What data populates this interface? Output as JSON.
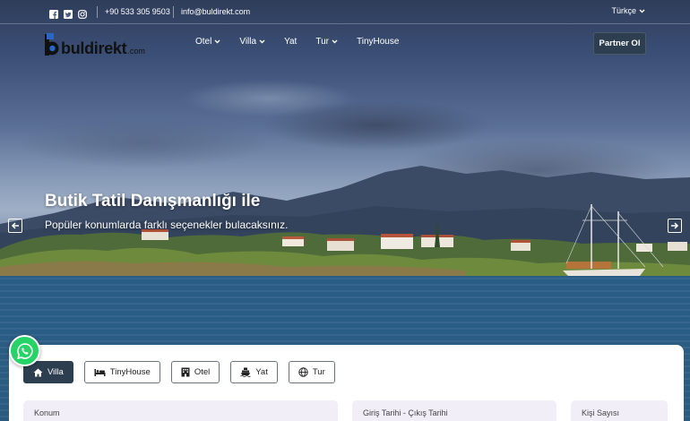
{
  "topbar": {
    "phone": "+90 533 305 9503",
    "email": "info@buldirekt.com",
    "language": "Türkçe",
    "social_icons": [
      "facebook-icon",
      "twitter-icon",
      "instagram-icon"
    ]
  },
  "logo": {
    "text": "buldirekt",
    "domain": ".com"
  },
  "nav": {
    "items": [
      {
        "label": "Otel",
        "dropdown": true
      },
      {
        "label": "Villa",
        "dropdown": true
      },
      {
        "label": "Yat",
        "dropdown": false
      },
      {
        "label": "Tur",
        "dropdown": true
      },
      {
        "label": "TinyHouse",
        "dropdown": false
      }
    ],
    "partner_label": "Partner Ol"
  },
  "hero": {
    "title": "Butik Tatil Danışmanlığı ile",
    "subtitle": "Popüler konumlarda farklı seçenekler bulacaksınız.",
    "prev_icon": "arrow-left-icon",
    "next_icon": "arrow-right-icon"
  },
  "search": {
    "tabs": [
      {
        "label": "Villa",
        "icon": "home-icon",
        "active": true
      },
      {
        "label": "TinyHouse",
        "icon": "bed-icon",
        "active": false
      },
      {
        "label": "Otel",
        "icon": "building-icon",
        "active": false
      },
      {
        "label": "Yat",
        "icon": "ship-icon",
        "active": false
      },
      {
        "label": "Tur",
        "icon": "globe-icon",
        "active": false
      }
    ],
    "fields": {
      "location_label": "Konum",
      "dates_label": "Giriş Tarihi - Çıkış Tarihi",
      "guests_label": "Kişi Sayısı"
    }
  },
  "colors": {
    "primary_dark": "#2c3e50",
    "whatsapp": "#25d366",
    "field_bg": "#f1eef8"
  }
}
